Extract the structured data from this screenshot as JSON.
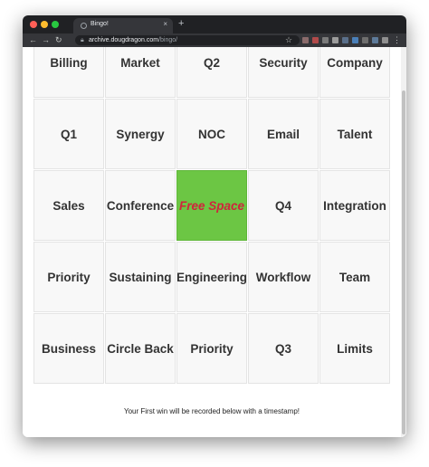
{
  "browser": {
    "tab_title": "Bingo!",
    "tab_close": "×",
    "new_tab": "+",
    "url_host": "archive.dougdragon.com",
    "url_path": "/bingo/",
    "icons": [
      "back-arrow-icon",
      "forward-arrow-icon",
      "reload-icon",
      "lock-icon",
      "star-icon",
      "kebab-menu-icon"
    ],
    "traffic_lights": {
      "red": "#ff5f57",
      "yellow": "#febc2e",
      "green": "#28c840"
    }
  },
  "bingo": {
    "rows": [
      [
        "Billing",
        "Market",
        "Q2",
        "Security",
        "Company"
      ],
      [
        "Q1",
        "Synergy",
        "NOC",
        "Email",
        "Talent"
      ],
      [
        "Sales",
        "Conference",
        "Free Space",
        "Q4",
        "Integration"
      ],
      [
        "Priority",
        "Sustaining",
        "Engineering",
        "Workflow",
        "Team"
      ],
      [
        "Business",
        "Circle Back",
        "Priority",
        "Q3",
        "Limits"
      ]
    ],
    "free_space_color": "#6cc644",
    "free_space_text_color": "#d0243c"
  },
  "footer": {
    "message": "Your First win will be recorded below with a timestamp!"
  }
}
